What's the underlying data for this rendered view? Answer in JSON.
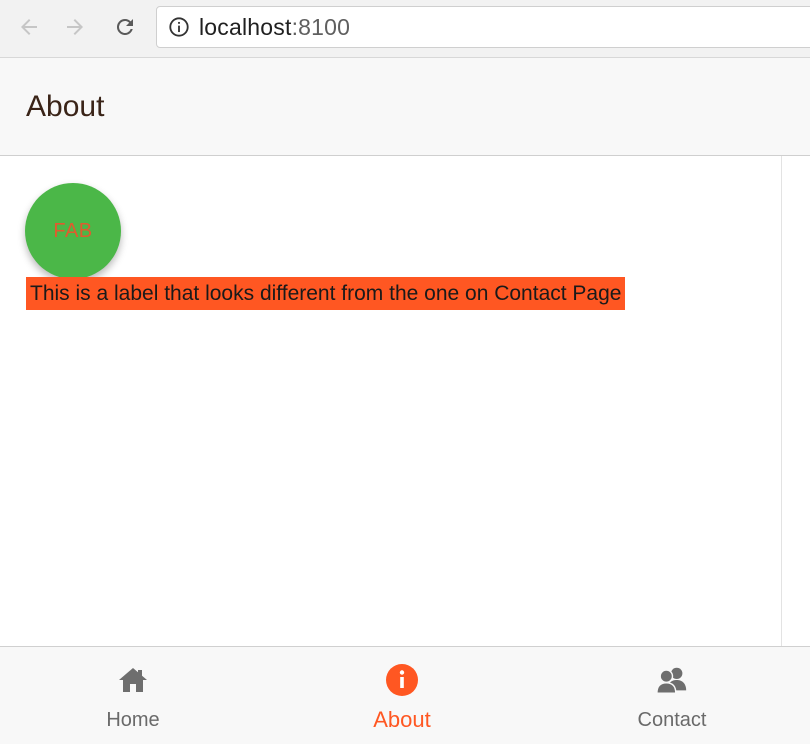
{
  "browser": {
    "url_host": "localhost",
    "url_port": ":8100"
  },
  "header": {
    "title": "About"
  },
  "content": {
    "fab_label": "FAB",
    "label_text": "This is a label that looks different from the one on Contact Page"
  },
  "tabs": [
    {
      "label": "Home",
      "icon": "home-icon",
      "active": false
    },
    {
      "label": "About",
      "icon": "info-icon",
      "active": true
    },
    {
      "label": "Contact",
      "icon": "contacts-icon",
      "active": false
    }
  ],
  "colors": {
    "accent": "#ff5722",
    "fab": "#4bb748",
    "fab_text": "#e05b2e"
  }
}
